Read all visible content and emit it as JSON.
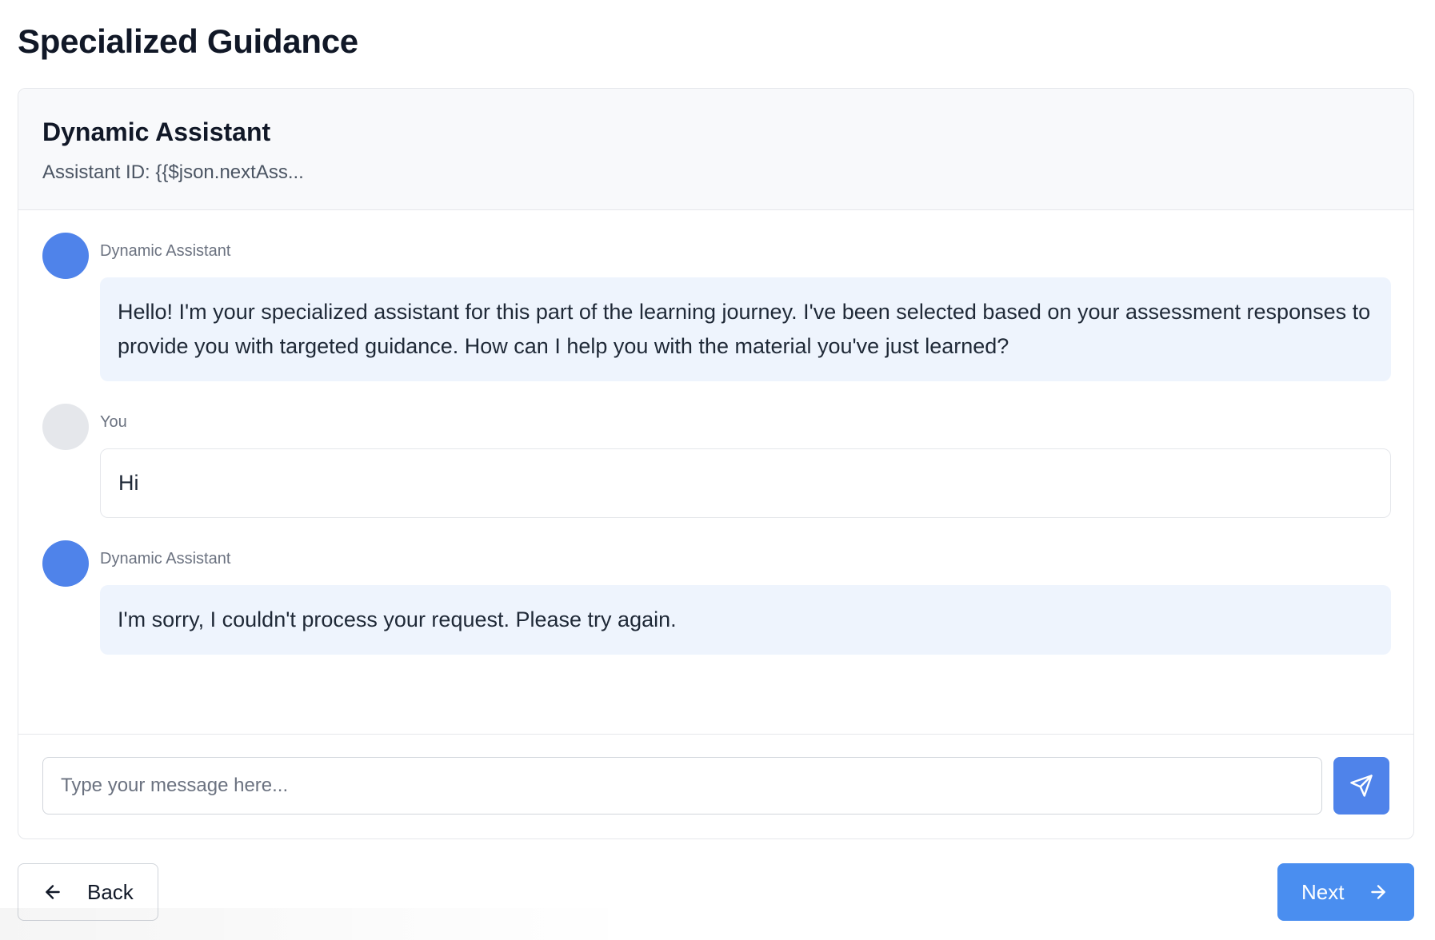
{
  "page": {
    "title": "Specialized Guidance"
  },
  "assistant": {
    "name": "Dynamic Assistant",
    "id_label": "Assistant ID: {{$json.nextAss..."
  },
  "messages": [
    {
      "role": "assistant",
      "sender": "Dynamic Assistant",
      "text": "Hello! I'm your specialized assistant for this part of the learning journey. I've been selected based on your assessment responses to provide you with targeted guidance. How can I help you with the material you've just learned?"
    },
    {
      "role": "user",
      "sender": "You",
      "text": "Hi"
    },
    {
      "role": "assistant",
      "sender": "Dynamic Assistant",
      "text": "I'm sorry, I couldn't process your request. Please try again."
    }
  ],
  "composer": {
    "placeholder": "Type your message here...",
    "value": "",
    "send_icon": "send-icon"
  },
  "navigation": {
    "back_label": "Back",
    "back_icon": "arrow-left-icon",
    "next_label": "Next",
    "next_icon": "arrow-right-icon"
  },
  "colors": {
    "accent": "#4f83ea",
    "next_button": "#4a8ef0",
    "assistant_bubble": "#eef4fd",
    "user_avatar": "#e5e7eb"
  }
}
